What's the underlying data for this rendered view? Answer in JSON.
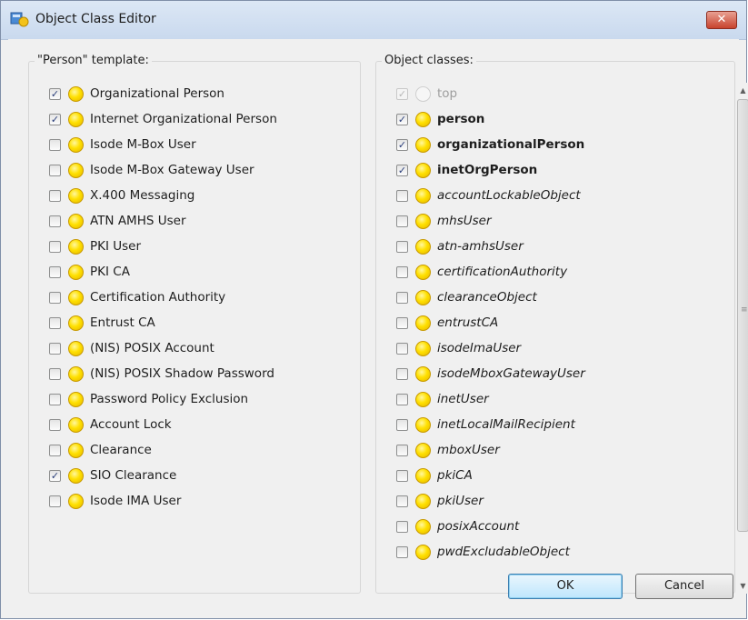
{
  "window": {
    "title": "Object Class Editor",
    "close_symbol": "✕"
  },
  "template_group": {
    "label": "\"Person\" template:",
    "items": [
      {
        "label": "Organizational Person",
        "checked": true
      },
      {
        "label": "Internet Organizational Person",
        "checked": true
      },
      {
        "label": "Isode M-Box User",
        "checked": false
      },
      {
        "label": "Isode M-Box Gateway User",
        "checked": false
      },
      {
        "label": "X.400 Messaging",
        "checked": false
      },
      {
        "label": "ATN AMHS User",
        "checked": false
      },
      {
        "label": "PKI User",
        "checked": false
      },
      {
        "label": "PKI CA",
        "checked": false
      },
      {
        "label": "Certification Authority",
        "checked": false
      },
      {
        "label": "Entrust CA",
        "checked": false
      },
      {
        "label": "(NIS) POSIX Account",
        "checked": false
      },
      {
        "label": "(NIS) POSIX Shadow Password",
        "checked": false
      },
      {
        "label": "Password Policy Exclusion",
        "checked": false
      },
      {
        "label": "Account Lock",
        "checked": false
      },
      {
        "label": "Clearance",
        "checked": false
      },
      {
        "label": "SIO Clearance",
        "checked": true
      },
      {
        "label": "Isode IMA User",
        "checked": false
      }
    ]
  },
  "classes_group": {
    "label": "Object classes:",
    "items": [
      {
        "label": "top",
        "checked": true,
        "style": "disabled"
      },
      {
        "label": "person",
        "checked": true,
        "style": "bold"
      },
      {
        "label": "organizationalPerson",
        "checked": true,
        "style": "bold"
      },
      {
        "label": "inetOrgPerson",
        "checked": true,
        "style": "bold"
      },
      {
        "label": "accountLockableObject",
        "checked": false,
        "style": "italic"
      },
      {
        "label": "mhsUser",
        "checked": false,
        "style": "italic"
      },
      {
        "label": "atn-amhsUser",
        "checked": false,
        "style": "italic"
      },
      {
        "label": "certificationAuthority",
        "checked": false,
        "style": "italic"
      },
      {
        "label": "clearanceObject",
        "checked": false,
        "style": "italic"
      },
      {
        "label": "entrustCA",
        "checked": false,
        "style": "italic"
      },
      {
        "label": "isodeImaUser",
        "checked": false,
        "style": "italic"
      },
      {
        "label": "isodeMboxGatewayUser",
        "checked": false,
        "style": "italic"
      },
      {
        "label": "inetUser",
        "checked": false,
        "style": "italic"
      },
      {
        "label": "inetLocalMailRecipient",
        "checked": false,
        "style": "italic"
      },
      {
        "label": "mboxUser",
        "checked": false,
        "style": "italic"
      },
      {
        "label": "pkiCA",
        "checked": false,
        "style": "italic"
      },
      {
        "label": "pkiUser",
        "checked": false,
        "style": "italic"
      },
      {
        "label": "posixAccount",
        "checked": false,
        "style": "italic"
      },
      {
        "label": "pwdExcludableObject",
        "checked": false,
        "style": "italic"
      }
    ]
  },
  "buttons": {
    "ok": "OK",
    "cancel": "Cancel"
  },
  "icons": {
    "class_icon": "yellow-circle-icon",
    "check_mark": "✓"
  }
}
